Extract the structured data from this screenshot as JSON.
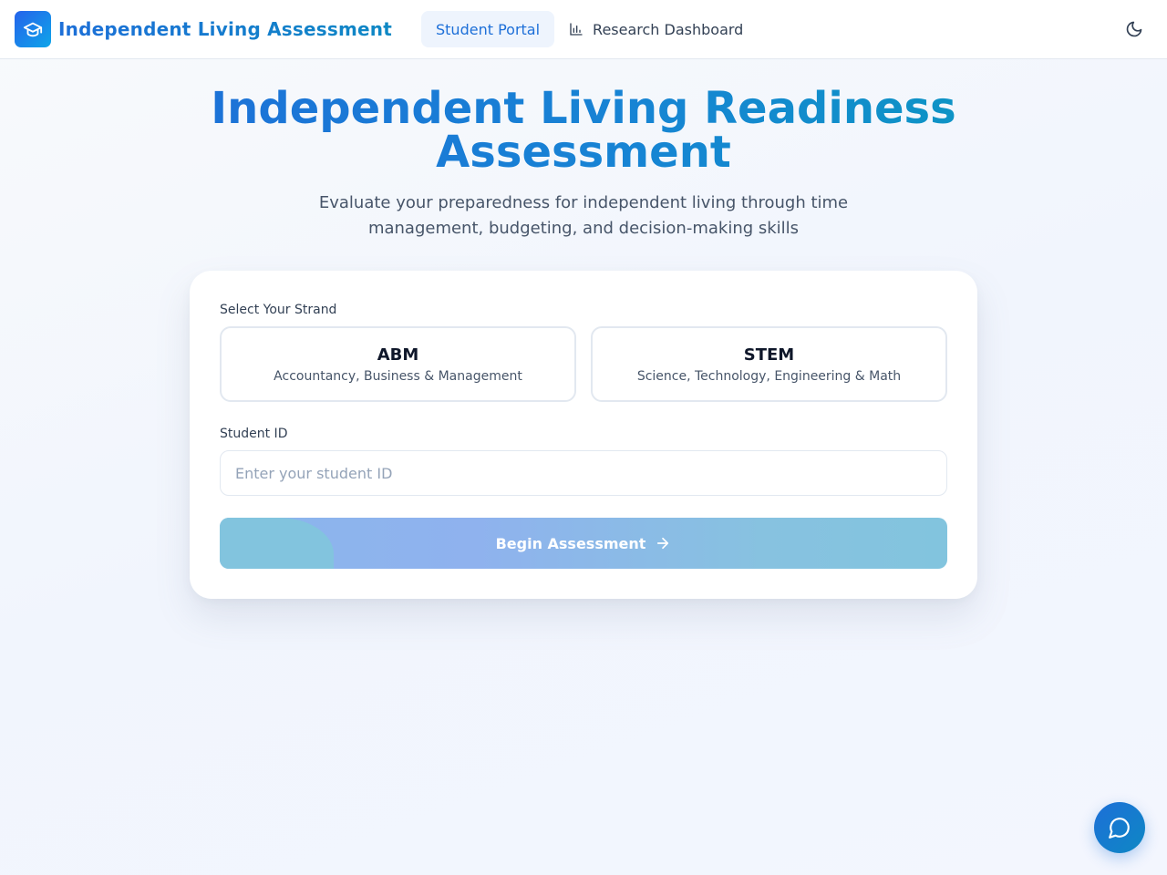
{
  "header": {
    "brand_title": "Independent Living Assessment",
    "brand_icon": "graduation-cap-icon",
    "nav": [
      {
        "label": "Student Portal",
        "active": true
      },
      {
        "label": "Research Dashboard",
        "icon": "bar-chart-icon",
        "active": false
      }
    ],
    "theme_toggle_icon": "moon-icon"
  },
  "hero": {
    "title": "Independent Living Readiness Assessment",
    "subtitle": "Evaluate your preparedness for independent living through time management, budgeting, and decision-making skills"
  },
  "form": {
    "strand_label": "Select Your Strand",
    "strands": [
      {
        "code": "ABM",
        "description": "Accountancy, Business & Management"
      },
      {
        "code": "STEM",
        "description": "Science, Technology, Engineering & Math"
      }
    ],
    "student_id_label": "Student ID",
    "student_id_placeholder": "Enter your student ID",
    "student_id_value": "",
    "submit_label": "Begin Assessment",
    "submit_icon": "arrow-right-icon"
  },
  "chat": {
    "icon": "chat-bubble-icon"
  },
  "colors": {
    "brand_primary": "#1d6fd8",
    "brand_secondary": "#0e88c4",
    "button_disabled": "#8bb6ec",
    "border": "#e2e8f0",
    "page_bg": "#f1f5fd"
  }
}
